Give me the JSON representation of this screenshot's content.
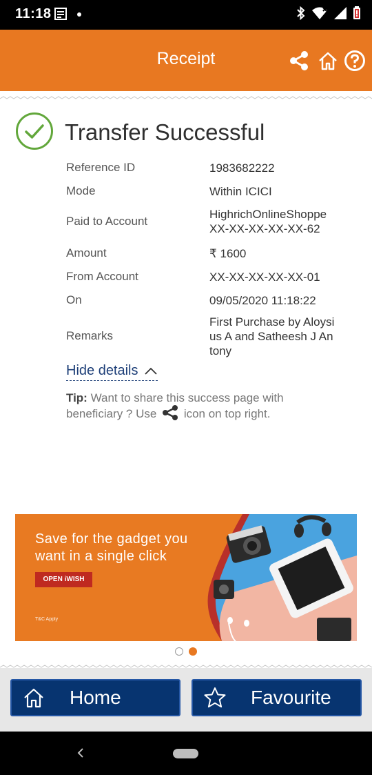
{
  "status_bar": {
    "time": "11:18"
  },
  "header": {
    "title": "Receipt",
    "icons": [
      "share-icon",
      "home-icon",
      "help-icon"
    ]
  },
  "status": {
    "title": "Transfer Successful",
    "icon": "check-circle-icon"
  },
  "details": [
    {
      "label": "Reference ID",
      "value": "1983682222"
    },
    {
      "label": "Mode",
      "value": "Within ICICI"
    },
    {
      "label": "Paid to Account",
      "value": "HighrichOnlineShoppe\nXX-XX-XX-XX-XX-62"
    },
    {
      "label": "Amount",
      "value": "₹ 1600"
    },
    {
      "label": "From Account",
      "value": "XX-XX-XX-XX-XX-01"
    },
    {
      "label": "On",
      "value": "09/05/2020 11:18:22"
    },
    {
      "label": "Remarks",
      "value": "First Purchase by Aloysi\nus A and Satheesh J An\ntony"
    }
  ],
  "hide_details": "Hide details",
  "tip": {
    "label": "Tip:",
    "text_before": "Want to share this success page with beneficiary ? Use",
    "text_after": "icon on top right."
  },
  "banner": {
    "headline_line1": "Save for the gadget you",
    "headline_line2": "want in a single click",
    "cta": "OPEN iWISH",
    "tnc": "T&C Apply"
  },
  "carousel": {
    "pages": 2,
    "active": 2
  },
  "footer": {
    "home_label": "Home",
    "favourite_label": "Favourite"
  },
  "colors": {
    "brand_orange": "#e87821",
    "success_green": "#62a73b",
    "navy": "#073470"
  }
}
